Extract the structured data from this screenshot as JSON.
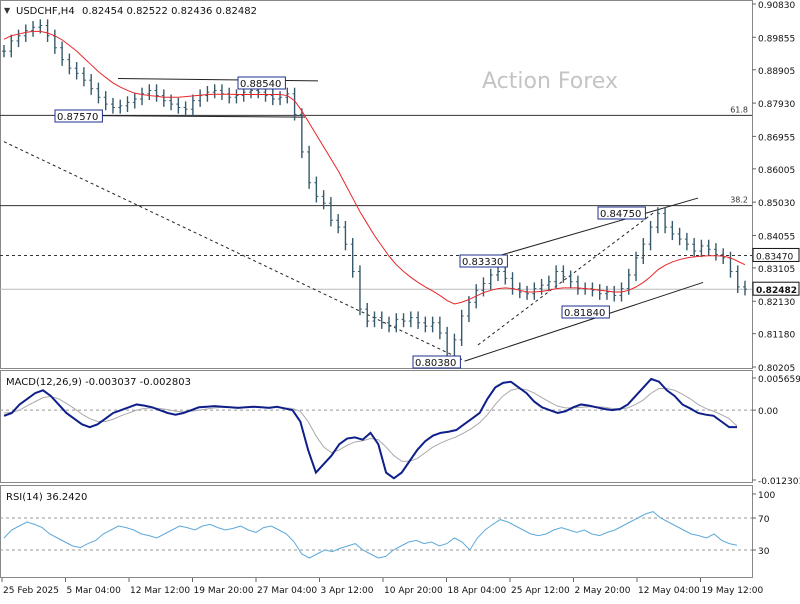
{
  "header": {
    "symbol_label": "USDCHF,H4",
    "ohlc_label": "0.82454 0.82522 0.82436 0.82482"
  },
  "watermark": "Action Forex",
  "colors": {
    "price": "#36596b",
    "ma": "#e8262a",
    "macd": "#0f1f8a",
    "signal": "#aaaaaa",
    "rsi": "#5fa9d9",
    "label_border": "#1f2f8f"
  },
  "chart_data": [
    {
      "type": "line",
      "panel": "price",
      "ylim": [
        0.80205,
        0.9083
      ],
      "yticks": [
        "0.90830",
        "0.89855",
        "0.88905",
        "0.87930",
        "0.86955",
        "0.86005",
        "0.85030",
        "0.84055",
        "0.83105",
        "0.82130",
        "0.81180",
        "0.80205"
      ],
      "xticks": [
        "25 Feb 2025",
        "5 Mar 04:00",
        "12 Mar 12:00",
        "19 Mar 20:00",
        "27 Mar 04:00",
        "3 Apr 12:00",
        "10 Apr 20:00",
        "18 Apr 04:00",
        "25 Apr 12:00",
        "2 May 20:00",
        "12 May 04:00",
        "19 May 12:00"
      ],
      "series": [
        {
          "role": "price",
          "values": [
            0.8945,
            0.8975,
            0.899,
            0.9005,
            0.9015,
            0.902,
            0.899,
            0.8955,
            0.892,
            0.8895,
            0.888,
            0.886,
            0.8835,
            0.881,
            0.879,
            0.878,
            0.8785,
            0.8795,
            0.8805,
            0.882,
            0.883,
            0.8815,
            0.88,
            0.879,
            0.878,
            0.8775,
            0.88,
            0.8815,
            0.8825,
            0.883,
            0.882,
            0.881,
            0.8815,
            0.8825,
            0.883,
            0.8825,
            0.8815,
            0.8805,
            0.881,
            0.882,
            0.876,
            0.865,
            0.856,
            0.852,
            0.85,
            0.845,
            0.843,
            0.838,
            0.83,
            0.819,
            0.8155,
            0.8165,
            0.815,
            0.814,
            0.816,
            0.8155,
            0.8165,
            0.815,
            0.814,
            0.815,
            0.812,
            0.805,
            0.81,
            0.817,
            0.821,
            0.8245,
            0.8265,
            0.829,
            0.83,
            0.828,
            0.825,
            0.824,
            0.8235,
            0.825,
            0.826,
            0.827,
            0.83,
            0.8285,
            0.827,
            0.825,
            0.825,
            0.8245,
            0.8235,
            0.824,
            0.823,
            0.825,
            0.829,
            0.834,
            0.838,
            0.843,
            0.847,
            0.843,
            0.841,
            0.8395,
            0.838,
            0.836,
            0.8375,
            0.8365,
            0.835,
            0.834,
            0.83,
            0.8255,
            0.8248
          ]
        },
        {
          "role": "moving-average",
          "values": [
            0.898,
            0.899,
            0.8995,
            0.9,
            0.9003,
            0.9003,
            0.8998,
            0.899,
            0.8978,
            0.8962,
            0.8945,
            0.8925,
            0.8905,
            0.8885,
            0.8868,
            0.8852,
            0.884,
            0.883,
            0.8822,
            0.8818,
            0.8815,
            0.8813,
            0.881,
            0.881,
            0.881,
            0.8812,
            0.8814,
            0.8816,
            0.8818,
            0.8819,
            0.8819,
            0.8819,
            0.8818,
            0.8818,
            0.8818,
            0.8818,
            0.8818,
            0.8818,
            0.8818,
            0.8815,
            0.88,
            0.877,
            0.8735,
            0.87,
            0.8665,
            0.863,
            0.8595,
            0.8555,
            0.8515,
            0.8475,
            0.844,
            0.8405,
            0.8375,
            0.8345,
            0.832,
            0.83,
            0.8283,
            0.8268,
            0.8255,
            0.8243,
            0.823,
            0.8215,
            0.8205,
            0.821,
            0.8218,
            0.8228,
            0.8238,
            0.8245,
            0.825,
            0.8252,
            0.825,
            0.8245,
            0.824,
            0.824,
            0.8242,
            0.8245,
            0.825,
            0.8252,
            0.8252,
            0.8252,
            0.825,
            0.8248,
            0.8245,
            0.8243,
            0.824,
            0.824,
            0.8245,
            0.8255,
            0.8268,
            0.8285,
            0.8305,
            0.8318,
            0.8328,
            0.8335,
            0.834,
            0.8343,
            0.8345,
            0.8346,
            0.8346,
            0.8345,
            0.834,
            0.833,
            0.832
          ]
        }
      ],
      "horizontal_lines": [
        {
          "value": 0.8757,
          "style": "solid",
          "label": "61.8"
        },
        {
          "value": 0.8493,
          "style": "solid",
          "label": "38.2"
        },
        {
          "value": 0.8347,
          "style": "dashed",
          "label": ""
        },
        {
          "value": 0.82482,
          "style": "solid-light",
          "label": ""
        }
      ],
      "point_labels": [
        "0.88540",
        "0.87570",
        "0.84750",
        "0.83330",
        "0.81840",
        "0.80380"
      ],
      "right_badges": [
        "0.83470",
        "0.82482"
      ]
    },
    {
      "type": "line",
      "panel": "macd",
      "title": "MACD(12,26,9) -0.003037 -0.002803",
      "ylim": [
        -0.012301,
        0.005659
      ],
      "yticks": [
        "0.005659",
        "0.00",
        "-0.012301"
      ],
      "zero_line": 0,
      "series": [
        {
          "role": "macd",
          "values": [
            -0.001,
            -0.0005,
            0.001,
            0.002,
            0.003,
            0.0035,
            0.0025,
            0.001,
            -0.0005,
            -0.0015,
            -0.0025,
            -0.003,
            -0.0025,
            -0.0015,
            -0.0005,
            0.0,
            0.0005,
            0.001,
            0.0008,
            0.0005,
            0.0,
            -0.0005,
            -0.0008,
            -0.0005,
            0.0,
            0.0005,
            0.0006,
            0.0007,
            0.0006,
            0.0005,
            0.0004,
            0.0005,
            0.0006,
            0.0005,
            0.0004,
            0.0006,
            0.0003,
            0.0,
            -0.002,
            -0.007,
            -0.011,
            -0.0095,
            -0.008,
            -0.006,
            -0.005,
            -0.0048,
            -0.0052,
            -0.004,
            -0.006,
            -0.011,
            -0.012,
            -0.011,
            -0.009,
            -0.007,
            -0.0055,
            -0.0045,
            -0.004,
            -0.0038,
            -0.0035,
            -0.0025,
            -0.0015,
            -0.0005,
            0.002,
            0.004,
            0.0048,
            0.005,
            0.004,
            0.003,
            0.0015,
            0.0005,
            0.0,
            -0.0005,
            -0.0002,
            0.0005,
            0.001,
            0.0008,
            0.0005,
            0.0002,
            0.0,
            0.0002,
            0.001,
            0.0025,
            0.004,
            0.0055,
            0.005,
            0.0035,
            0.0025,
            0.001,
            0.0003,
            -0.0005,
            -0.0008,
            -0.001,
            -0.002,
            -0.003,
            -0.003
          ]
        },
        {
          "role": "signal",
          "values": [
            -0.0005,
            -0.0004,
            0.0,
            0.0008,
            0.0015,
            0.0022,
            0.0024,
            0.002,
            0.0012,
            0.0003,
            -0.0007,
            -0.0015,
            -0.002,
            -0.002,
            -0.0016,
            -0.001,
            -0.0005,
            0.0,
            0.0003,
            0.0004,
            0.0003,
            0.0001,
            -0.0002,
            -0.0003,
            -0.0002,
            0.0,
            0.0002,
            0.0004,
            0.0005,
            0.0005,
            0.0005,
            0.0005,
            0.0005,
            0.0005,
            0.0005,
            0.0005,
            0.0004,
            0.0003,
            -0.0002,
            -0.002,
            -0.0045,
            -0.0065,
            -0.0075,
            -0.007,
            -0.0062,
            -0.0056,
            -0.0054,
            -0.005,
            -0.0052,
            -0.0065,
            -0.008,
            -0.009,
            -0.009,
            -0.0085,
            -0.0075,
            -0.0065,
            -0.0058,
            -0.0052,
            -0.0047,
            -0.004,
            -0.0032,
            -0.0022,
            -0.0008,
            0.001,
            0.0025,
            0.0035,
            0.0038,
            0.0036,
            0.003,
            0.0022,
            0.0014,
            0.0007,
            0.0004,
            0.0004,
            0.0005,
            0.0006,
            0.0006,
            0.0005,
            0.0003,
            0.0002,
            0.0004,
            0.001,
            0.0018,
            0.003,
            0.0038,
            0.0038,
            0.0035,
            0.0028,
            0.002,
            0.001,
            0.0003,
            -0.0002,
            -0.0008,
            -0.0015,
            -0.0028
          ]
        }
      ]
    },
    {
      "type": "line",
      "panel": "rsi",
      "title": "RSI(14) 36.2420",
      "ylim": [
        0,
        100
      ],
      "yticks": [
        "100",
        "70",
        "30",
        "0"
      ],
      "levels": [
        70,
        30
      ],
      "series": [
        {
          "role": "rsi",
          "values": [
            45,
            55,
            60,
            65,
            62,
            58,
            50,
            45,
            40,
            35,
            33,
            38,
            42,
            50,
            55,
            60,
            58,
            55,
            50,
            48,
            45,
            50,
            55,
            60,
            58,
            55,
            60,
            62,
            58,
            55,
            57,
            60,
            55,
            52,
            58,
            60,
            55,
            50,
            40,
            25,
            20,
            25,
            30,
            28,
            32,
            35,
            38,
            30,
            25,
            20,
            22,
            30,
            35,
            40,
            42,
            38,
            40,
            35,
            38,
            45,
            40,
            30,
            45,
            55,
            62,
            68,
            65,
            60,
            55,
            50,
            48,
            50,
            55,
            58,
            55,
            52,
            55,
            50,
            48,
            52,
            55,
            60,
            65,
            70,
            75,
            78,
            70,
            65,
            60,
            55,
            50,
            48,
            45,
            50,
            42,
            38,
            36
          ]
        }
      ]
    }
  ]
}
